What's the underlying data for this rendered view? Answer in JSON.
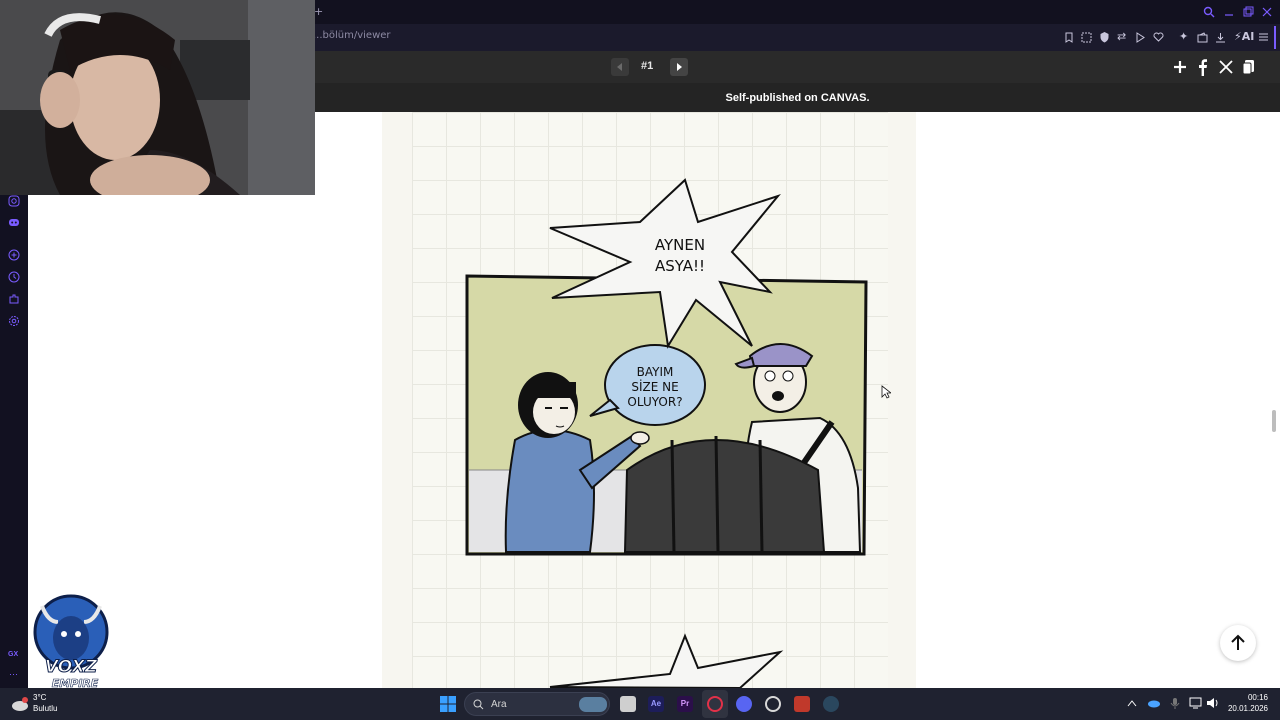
{
  "browser": {
    "url": "...bölüm/viewer",
    "new_tab": "+"
  },
  "viewer": {
    "episode": "#1",
    "published": "Self-published on CANVAS."
  },
  "comic": {
    "shout_text": "AYNEN\nASYA!!",
    "question_text": "BAYIM\nSİZE NE\nOLUYOR?"
  },
  "logo": {
    "line1": "VOXZ",
    "line2": "EMPIRE"
  },
  "taskbar": {
    "weather_temp": "3°C",
    "weather_desc": "Bulutlu",
    "search_placeholder": "Ara",
    "time": "00:16",
    "date": "20.01.2026"
  },
  "colors": {
    "chrome_dark": "#12111f",
    "accent": "#7a5cff",
    "panel_bg": "#d6d9a7",
    "hoodie": "#6a8cbf",
    "cap": "#9a93c8",
    "speech_bubble": "#b9d4ec"
  }
}
